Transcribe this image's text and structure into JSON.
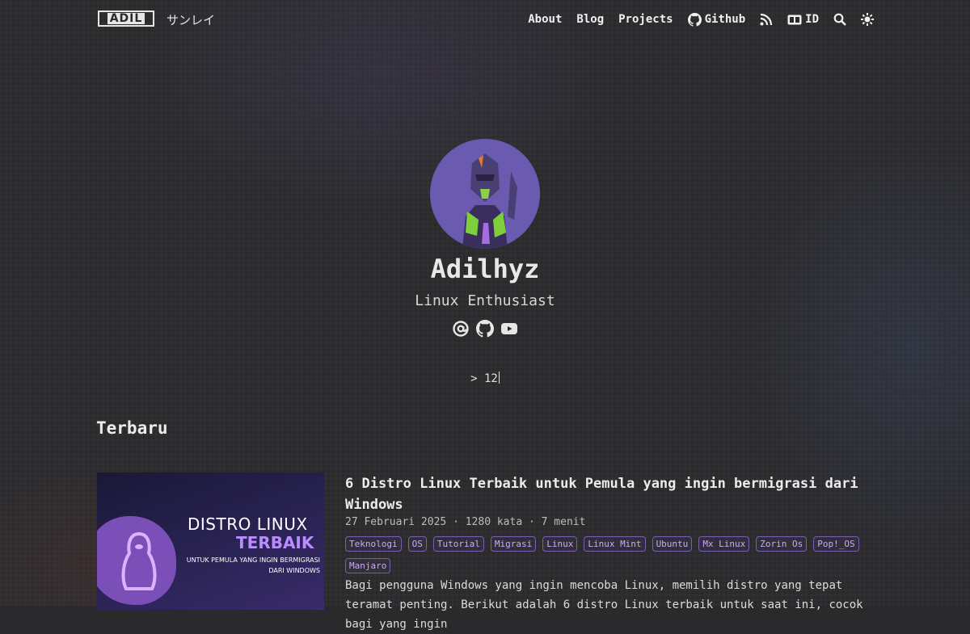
{
  "header": {
    "logo_text": "ADIL",
    "site_subtitle": "サンレイ",
    "nav": [
      {
        "label": "About"
      },
      {
        "label": "Blog"
      },
      {
        "label": "Projects"
      },
      {
        "label": "Github",
        "icon": "github-icon"
      },
      {
        "label": "",
        "icon": "rss-icon"
      },
      {
        "label": "ID",
        "icon": "language-icon"
      },
      {
        "label": "",
        "icon": "search-icon"
      },
      {
        "label": "",
        "icon": "theme-toggle-icon"
      }
    ]
  },
  "profile": {
    "name": "Adilhyz",
    "tagline": "Linux Enthusiast",
    "socials": [
      "email-icon",
      "github-icon",
      "youtube-icon"
    ],
    "typed_text": "> 12"
  },
  "recent": {
    "section_title": "Terbaru",
    "posts": [
      {
        "title": "6 Distro Linux Terbaik untuk Pemula yang ingin bermigrasi dari Windows",
        "date": "27 Februari 2025",
        "words": "1280 kata",
        "read_time": "7 menit",
        "meta_separator": "·",
        "tags": [
          "Teknologi",
          "OS",
          "Tutorial",
          "Migrasi",
          "Linux",
          "Linux Mint",
          "Ubuntu",
          "Mx Linux",
          "Zorin Os",
          "Pop!_OS",
          "Manjaro"
        ],
        "summary": "Bagi pengguna Windows yang ingin mencoba Linux, memilih distro yang tepat teramat penting. Berikut adalah 6 distro Linux terbaik untuk saat ini, cocok bagi yang ingin",
        "thumbnail": {
          "line1": "DISTRO LINUX",
          "line2": "TERBAIK",
          "line3": "UNTUK PEMULA YANG INGIN BERMIGRASI DARI WINDOWS"
        }
      }
    ]
  },
  "colors": {
    "background": "#2a2a2d",
    "text": "#e6e6e6",
    "tag_accent": "#c9a9ff",
    "thumbnail_accent": "#7b4fb8"
  }
}
